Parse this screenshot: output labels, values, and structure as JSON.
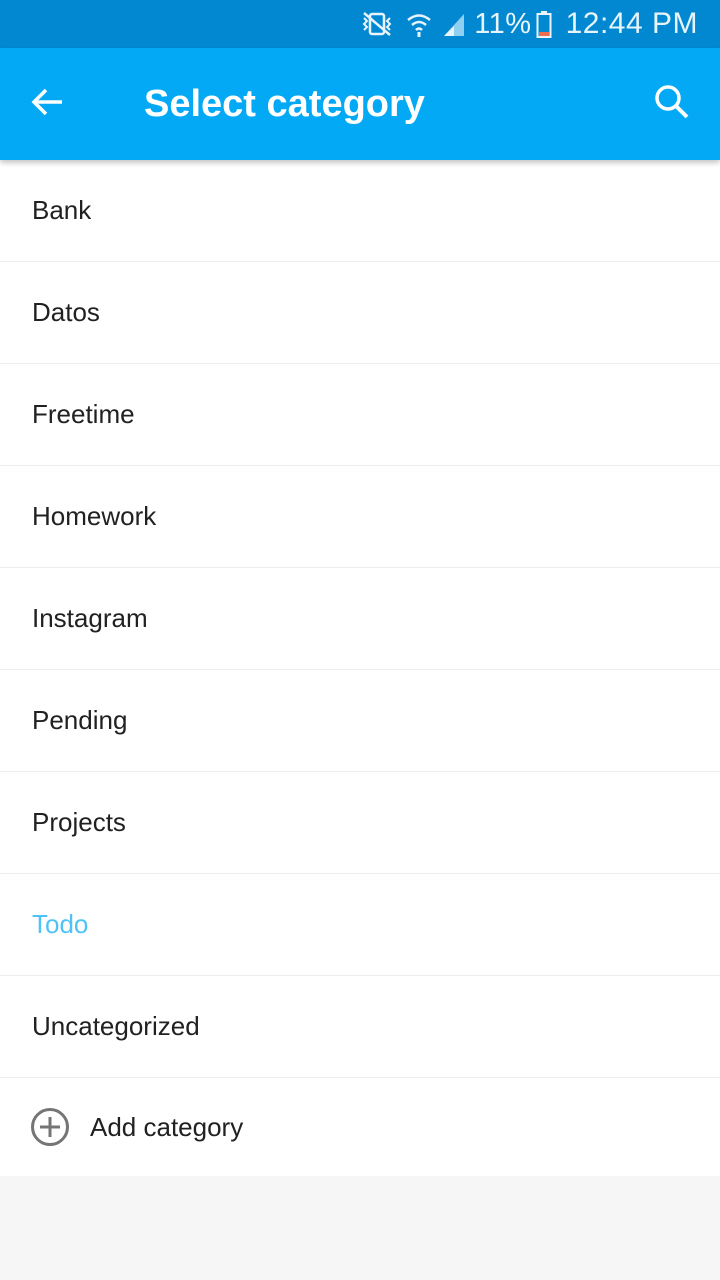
{
  "status_bar": {
    "icons": [
      "vibrate-mute-icon",
      "wifi-icon",
      "signal-icon",
      "battery-icon"
    ],
    "battery_percent": "11%",
    "time": "12:44 PM",
    "color": "#0288d1"
  },
  "app_bar": {
    "back_icon": "arrow-back-icon",
    "title": "Select category",
    "search_icon": "search-icon",
    "color": "#03a9f4"
  },
  "categories": [
    {
      "label": "Bank",
      "selected": false
    },
    {
      "label": "Datos",
      "selected": false
    },
    {
      "label": "Freetime",
      "selected": false
    },
    {
      "label": "Homework",
      "selected": false
    },
    {
      "label": "Instagram",
      "selected": false
    },
    {
      "label": "Pending",
      "selected": false
    },
    {
      "label": "Projects",
      "selected": false
    },
    {
      "label": "Todo",
      "selected": true
    },
    {
      "label": "Uncategorized",
      "selected": false
    }
  ],
  "add_category": {
    "icon": "add-circle-icon",
    "label": "Add category"
  },
  "colors": {
    "selected_text": "#4fc3f7",
    "text": "#212121"
  }
}
